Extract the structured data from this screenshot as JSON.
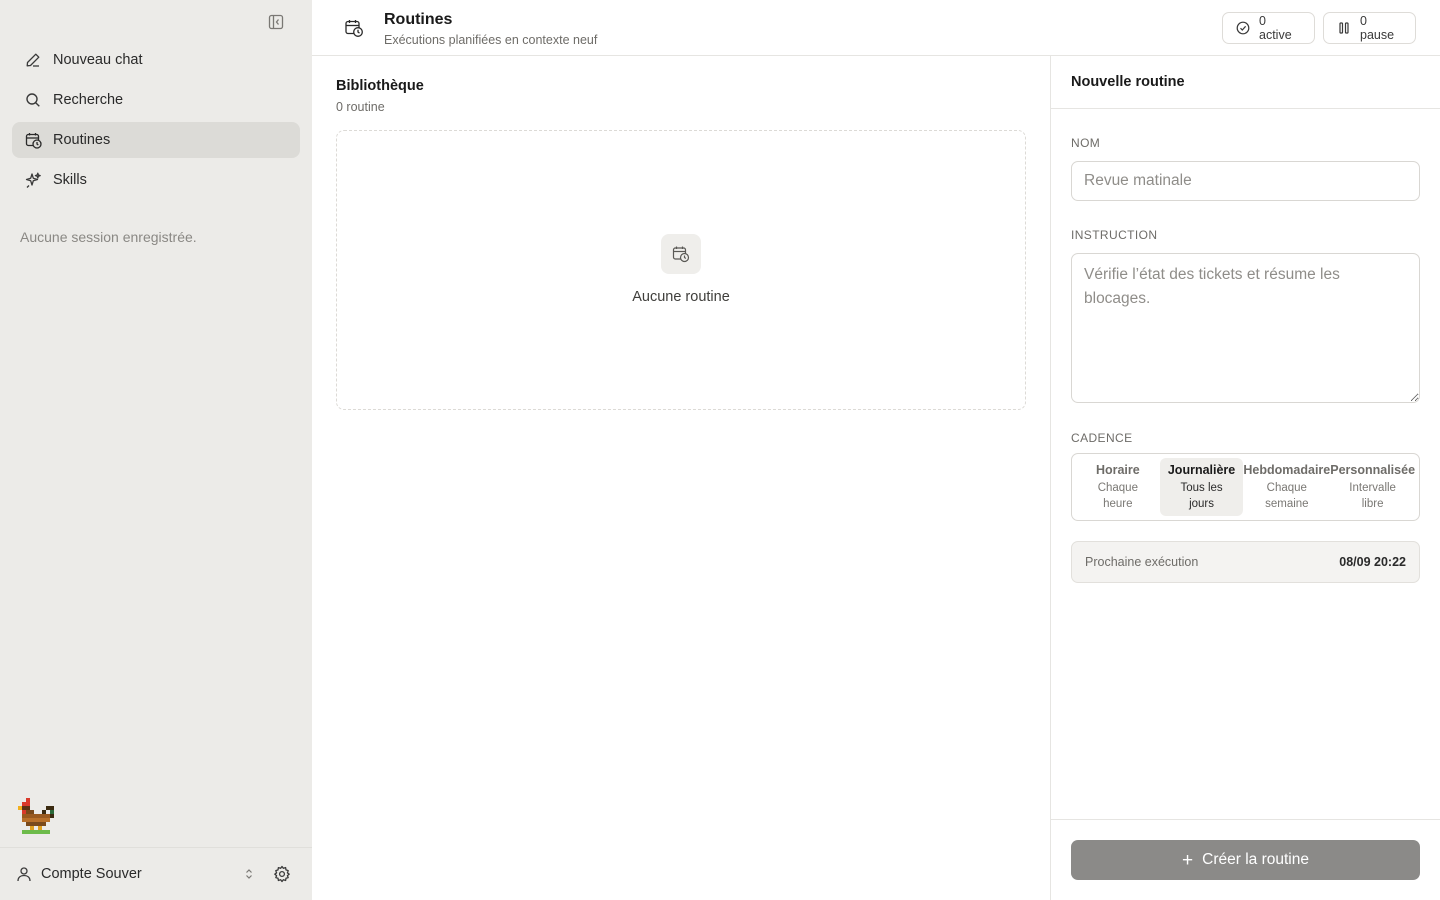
{
  "sidebar": {
    "items": [
      {
        "label": "Nouveau chat",
        "icon": "pencil-icon"
      },
      {
        "label": "Recherche",
        "icon": "search-icon"
      },
      {
        "label": "Routines",
        "icon": "calendar-clock-icon",
        "active": true
      },
      {
        "label": "Skills",
        "icon": "sparkles-icon"
      }
    ],
    "empty_sessions": "Aucune session enregistrée.",
    "account_name": "Compte Souver"
  },
  "header": {
    "title": "Routines",
    "subtitle": "Exécutions planifiées en contexte neuf",
    "active_label": "0 active",
    "pause_label": "0 pause"
  },
  "library": {
    "title": "Bibliothèque",
    "count": "0 routine",
    "empty_text": "Aucune routine"
  },
  "panel": {
    "title": "Nouvelle routine",
    "name_label": "NOM",
    "name_placeholder": "Revue matinale",
    "instruction_label": "INSTRUCTION",
    "instruction_placeholder": "Vérifie l’état des tickets et résume les blocages.",
    "cadence_label": "CADENCE",
    "cadence_options": [
      {
        "name": "Horaire",
        "desc": "Chaque heure"
      },
      {
        "name": "Journalière",
        "desc": "Tous les jours",
        "selected": true
      },
      {
        "name": "Hebdomadaire",
        "desc": "Chaque semaine"
      },
      {
        "name": "Personnalisée",
        "desc": "Intervalle libre"
      }
    ],
    "next_run_label": "Prochaine exécution",
    "next_run_value": "08/09 20:22",
    "create_label": "Créer la routine"
  },
  "colors": {
    "sidebar_bg": "#ecebe8",
    "active_nav_bg": "#dcdbd7",
    "create_button_bg": "#8b8a88"
  }
}
